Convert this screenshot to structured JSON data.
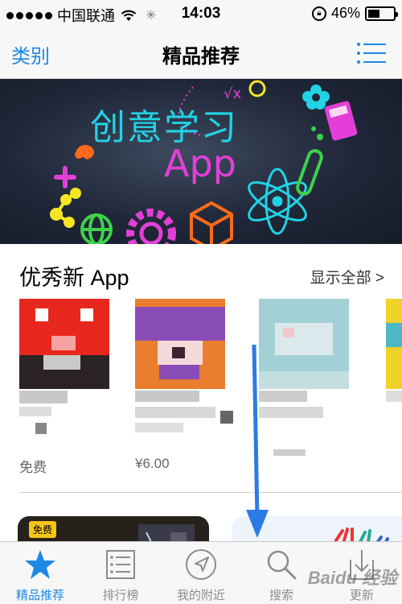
{
  "status_bar": {
    "carrier": "中国联通",
    "time": "14:03",
    "battery": "46%",
    "battery_level": 0.46
  },
  "nav": {
    "left_label": "类别",
    "title": "精品推荐"
  },
  "banner": {
    "title": "创意学习",
    "subtitle": "App"
  },
  "section": {
    "title": "优秀新 App",
    "see_all": "显示全部 >",
    "apps": [
      {
        "price": "免费"
      },
      {
        "price": "¥6.00"
      },
      {
        "price": ""
      },
      {
        "price": ""
      }
    ]
  },
  "featured": {
    "card1_badge": "免费"
  },
  "tabs": [
    {
      "label": "精品推荐",
      "icon": "star-icon",
      "active": true
    },
    {
      "label": "排行榜",
      "icon": "list-icon",
      "active": false
    },
    {
      "label": "我的附近",
      "icon": "location-arrow-icon",
      "active": false
    },
    {
      "label": "搜索",
      "icon": "search-icon",
      "active": false
    },
    {
      "label": "更新",
      "icon": "download-icon",
      "active": false
    }
  ],
  "watermark": "Baidu 经验",
  "colors": {
    "accent": "#1e88e5",
    "tab_inactive": "#8c8c8c"
  }
}
